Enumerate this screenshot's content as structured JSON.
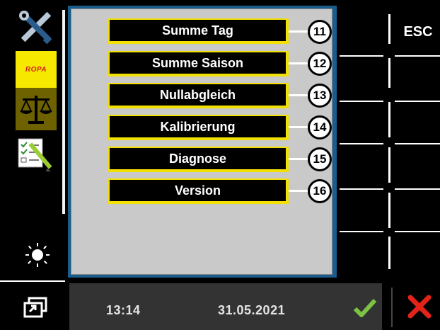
{
  "menu": {
    "items": [
      {
        "label": "Summe Tag",
        "number": "11"
      },
      {
        "label": "Summe Saison",
        "number": "12"
      },
      {
        "label": "Nullabgleich",
        "number": "13"
      },
      {
        "label": "Kalibrierung",
        "number": "14"
      },
      {
        "label": "Diagnose",
        "number": "15"
      },
      {
        "label": "Version",
        "number": "16"
      }
    ]
  },
  "sidebar": {
    "brand_text": "ROPA",
    "icons": [
      "tools-icon",
      "scale-icon",
      "checklist-icon",
      "brightness-icon"
    ]
  },
  "right_panel": {
    "esc_label": "ESC"
  },
  "status": {
    "time": "13:14",
    "date": "31.05.2021"
  },
  "colors": {
    "accent_yellow": "#f1e000",
    "brand_red": "#d4201a",
    "confirm_green": "#7dc242",
    "cancel_red": "#e2231a",
    "frame_blue": "#1a5c8c"
  }
}
